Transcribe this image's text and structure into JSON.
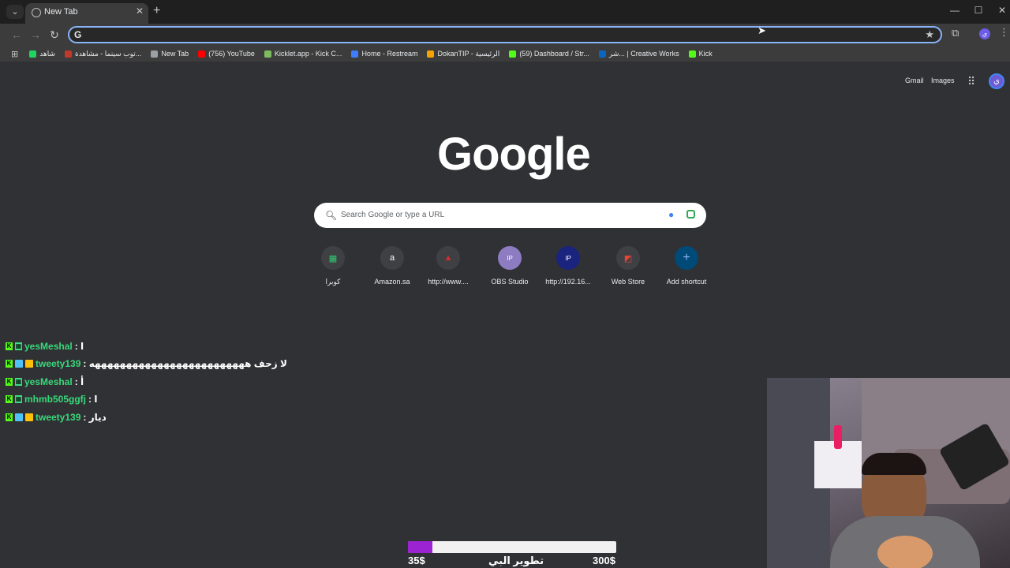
{
  "browser": {
    "tab_title": "New Tab",
    "omnibox_value": "",
    "bookmarks": [
      {
        "label": "شاهد",
        "color": "#1ed760"
      },
      {
        "label": "توب سينما - مشاهدة...",
        "color": "#c0392b"
      },
      {
        "label": "New Tab",
        "color": "#9aa0a6"
      },
      {
        "label": "(756) YouTube",
        "color": "#ff0000"
      },
      {
        "label": "Kicklet.app - Kick C...",
        "color": "#7dbb5e"
      },
      {
        "label": "Home - Restream",
        "color": "#3f7cff"
      },
      {
        "label": "DokanTIP - الرئيسية",
        "color": "#f4a300"
      },
      {
        "label": "(59) Dashboard / Str...",
        "color": "#53fc18"
      },
      {
        "label": "شر... | Creative Works",
        "color": "#0a66c2"
      },
      {
        "label": "Kick",
        "color": "#53fc18"
      }
    ]
  },
  "ntp": {
    "gmail": "Gmail",
    "images": "Images",
    "account_initial": "ي",
    "logo": "Google",
    "search_placeholder": "Search Google or type a URL",
    "shortcuts": [
      {
        "label": "كوبرا",
        "icon": "grid-green",
        "glyph": "▦",
        "color": "#2ecc71"
      },
      {
        "label": "Amazon.sa",
        "icon": "amazon",
        "glyph": "a",
        "color": "#ffffff"
      },
      {
        "label": "http://www....",
        "icon": "car-red",
        "glyph": "▲",
        "color": "#d32f2f"
      },
      {
        "label": "OBS Studio",
        "icon": "ip-purple",
        "glyph": "IP",
        "color": "#8e7cc3"
      },
      {
        "label": "http://192.16...",
        "icon": "ip-blue",
        "glyph": "IP",
        "color": "#1a237e"
      },
      {
        "label": "Web Store",
        "icon": "webstore",
        "glyph": "◩",
        "color": "#ea4335"
      },
      {
        "label": "Add shortcut",
        "icon": "plus",
        "glyph": "+",
        "color": "#8ab4f8"
      }
    ]
  },
  "chat": [
    {
      "name": "yesMeshal",
      "message": ": ا",
      "badge": "a"
    },
    {
      "name": "tweety139",
      "message": ": لا زحف هههههههههههههههههههههههههه",
      "badge": "b"
    },
    {
      "name": "yesMeshal",
      "message": ": أ",
      "badge": "a"
    },
    {
      "name": "mhmb505ggfj",
      "message": ": ا",
      "badge": "a"
    },
    {
      "name": "tweety139",
      "message": ": ديار",
      "badge": "b"
    }
  ],
  "goal": {
    "current": "35$",
    "title": "تطوير البي",
    "target": "300$",
    "fraction": 0.117
  }
}
